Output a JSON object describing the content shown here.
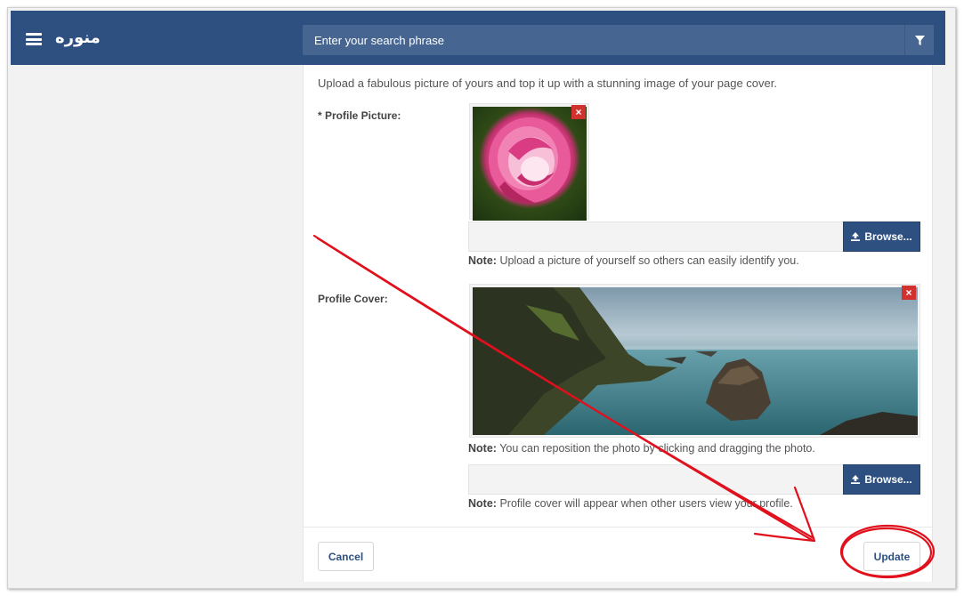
{
  "header": {
    "brand": "منوره",
    "search_placeholder": "Enter your search phrase",
    "menu_icon": "hamburger-menu-icon",
    "filter_icon": "filter-icon"
  },
  "form": {
    "intro": "Upload a fabulous picture of yours and top it up with a stunning image of your page cover.",
    "profile_picture": {
      "label": "* Profile Picture:",
      "remove_glyph": "×",
      "browse_label": "Browse...",
      "note_bold": "Note:",
      "note_text": "Upload a picture of yourself so others can easily identify you."
    },
    "profile_cover": {
      "label": "Profile Cover:",
      "remove_glyph": "×",
      "reposition_note_bold": "Note:",
      "reposition_note_text": "You can reposition the photo by clicking and dragging the photo.",
      "browse_label": "Browse...",
      "note_bold": "Note:",
      "note_text": "Profile cover will appear when other users view your profile."
    },
    "cancel_label": "Cancel",
    "update_label": "Update"
  },
  "colors": {
    "header_bg": "#2d5081",
    "search_bg": "#466591",
    "remove_red": "#d2322d",
    "annotation_red": "#e0101c"
  }
}
